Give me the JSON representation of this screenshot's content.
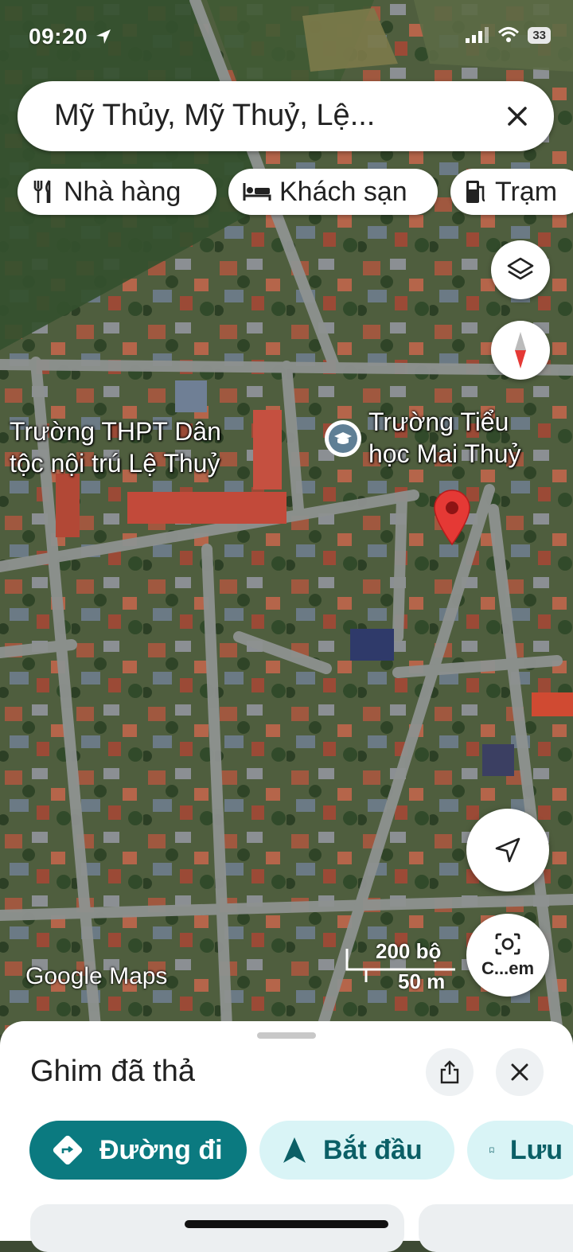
{
  "status": {
    "time": "09:20",
    "battery": "33"
  },
  "search": {
    "query": "Mỹ Thủy, Mỹ Thuỷ, Lệ..."
  },
  "chips": [
    {
      "label": "Nhà hàng",
      "icon": "restaurant-icon"
    },
    {
      "label": "Khách sạn",
      "icon": "hotel-icon"
    },
    {
      "label": "Trạm",
      "icon": "gas-station-icon"
    }
  ],
  "map": {
    "labels": {
      "school1_line1": "Trường THPT Dân",
      "school1_line2": "tộc nội trú Lệ Thuỷ",
      "school2_line1": "Trường Tiểu",
      "school2_line2": "học Mai Thuỷ"
    },
    "scale": {
      "imperial": "200 bộ",
      "metric": "50 m"
    },
    "watermark": "Google Maps",
    "camera_label": "C...em",
    "pin_color": "#e53935"
  },
  "sheet": {
    "title": "Ghim đã thả",
    "actions": [
      {
        "label": "Đường đi",
        "icon": "directions-icon"
      },
      {
        "label": "Bắt đầu",
        "icon": "navigation-arrow-icon"
      },
      {
        "label": "Lưu",
        "icon": "bookmark-icon"
      }
    ]
  },
  "colors": {
    "accent": "#0b7a80",
    "accent_light": "#d9f4f6",
    "pin": "#e53935"
  }
}
